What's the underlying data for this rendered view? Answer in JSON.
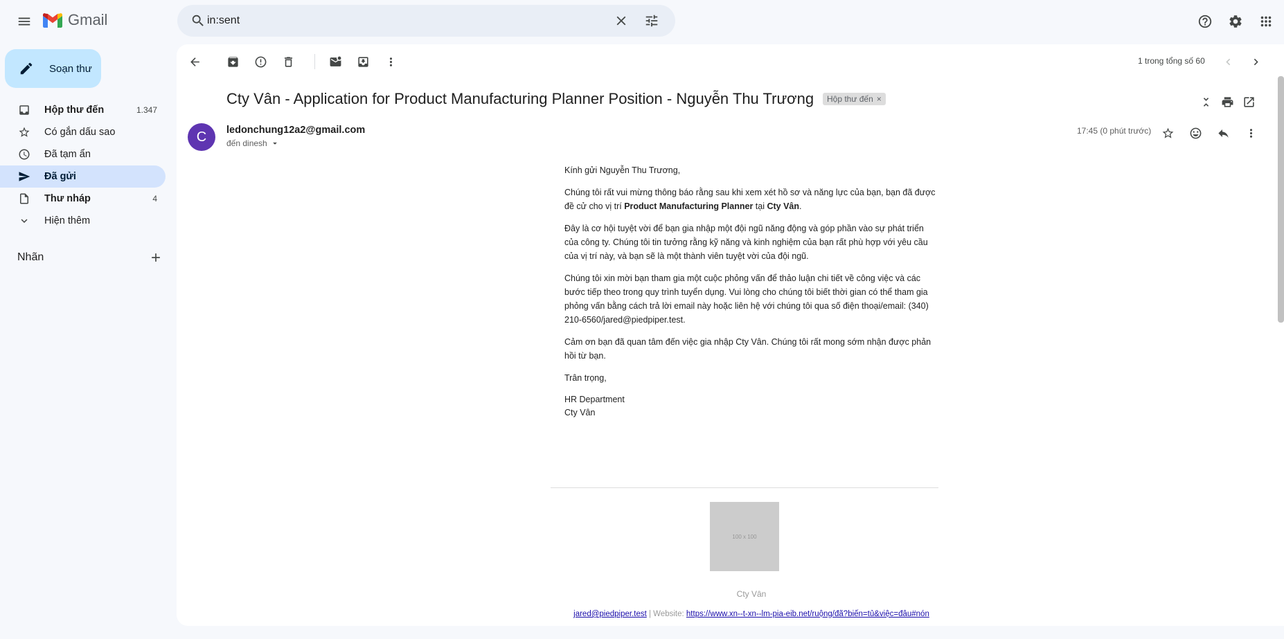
{
  "app": {
    "name": "Gmail"
  },
  "search": {
    "query": "in:sent"
  },
  "compose": {
    "label": "Soạn thư"
  },
  "sidebar": {
    "items": [
      {
        "label": "Hộp thư đến",
        "count": "1.347"
      },
      {
        "label": "Có gắn dấu sao",
        "count": ""
      },
      {
        "label": "Đã tạm ẩn",
        "count": ""
      },
      {
        "label": "Đã gửi",
        "count": ""
      },
      {
        "label": "Thư nháp",
        "count": "4"
      },
      {
        "label": "Hiện thêm",
        "count": ""
      }
    ],
    "labels_heading": "Nhãn"
  },
  "toolbar": {
    "pager": "1 trong tổng số 60"
  },
  "message": {
    "subject": "Cty Vân - Application for Product Manufacturing Planner Position - Nguyễn Thu Trương",
    "tag": "Hộp thư đến",
    "tag_close": "×",
    "avatar_letter": "C",
    "sender": "ledonchung12a2@gmail.com",
    "to": "đến dinesh",
    "time": "17:45 (0 phút trước)"
  },
  "email_body": {
    "greeting": "Kính gửi Nguyễn Thu Trương,",
    "p1_a": "Chúng tôi rất vui mừng thông báo rằng sau khi xem xét hồ sơ và năng lực của bạn, bạn đã được đề cử cho vị trí ",
    "p1_position": "Product Manufacturing Planner",
    "p1_b": " tại ",
    "p1_company": "Cty Vân",
    "p1_c": ".",
    "p2": "Đây là cơ hội tuyệt vời để bạn gia nhập một đội ngũ năng động và góp phần vào sự phát triển của công ty. Chúng tôi tin tưởng rằng kỹ năng và kinh nghiệm của bạn rất phù hợp với yêu cầu của vị trí này, và bạn sẽ là một thành viên tuyệt vời của đội ngũ.",
    "p3": "Chúng tôi xin mời bạn tham gia một cuộc phỏng vấn để thảo luận chi tiết về công việc và các bước tiếp theo trong quy trình tuyển dụng. Vui lòng cho chúng tôi biết thời gian có thể tham gia phỏng vấn bằng cách trả lời email này hoặc liên hệ với chúng tôi qua số điện thoại/email: (340) 210-6560/jared@piedpiper.test.",
    "p4": "Cảm ơn bạn đã quan tâm đến việc gia nhập Cty Vân. Chúng tôi rất mong sớm nhận được phản hồi từ bạn.",
    "closing": "Trân trọng,",
    "sig_dept": "HR Department",
    "sig_company": "Cty Vân"
  },
  "footer": {
    "image_placeholder": "100 x 100",
    "company": "Cty Vân",
    "email": "jared@piedpiper.test",
    "website_label": " | Website: ",
    "website": "https://www.xn--t-xn--lm-pia-eib.net/ruộng/đã?biến=tủ&việc=đâu#nón"
  }
}
